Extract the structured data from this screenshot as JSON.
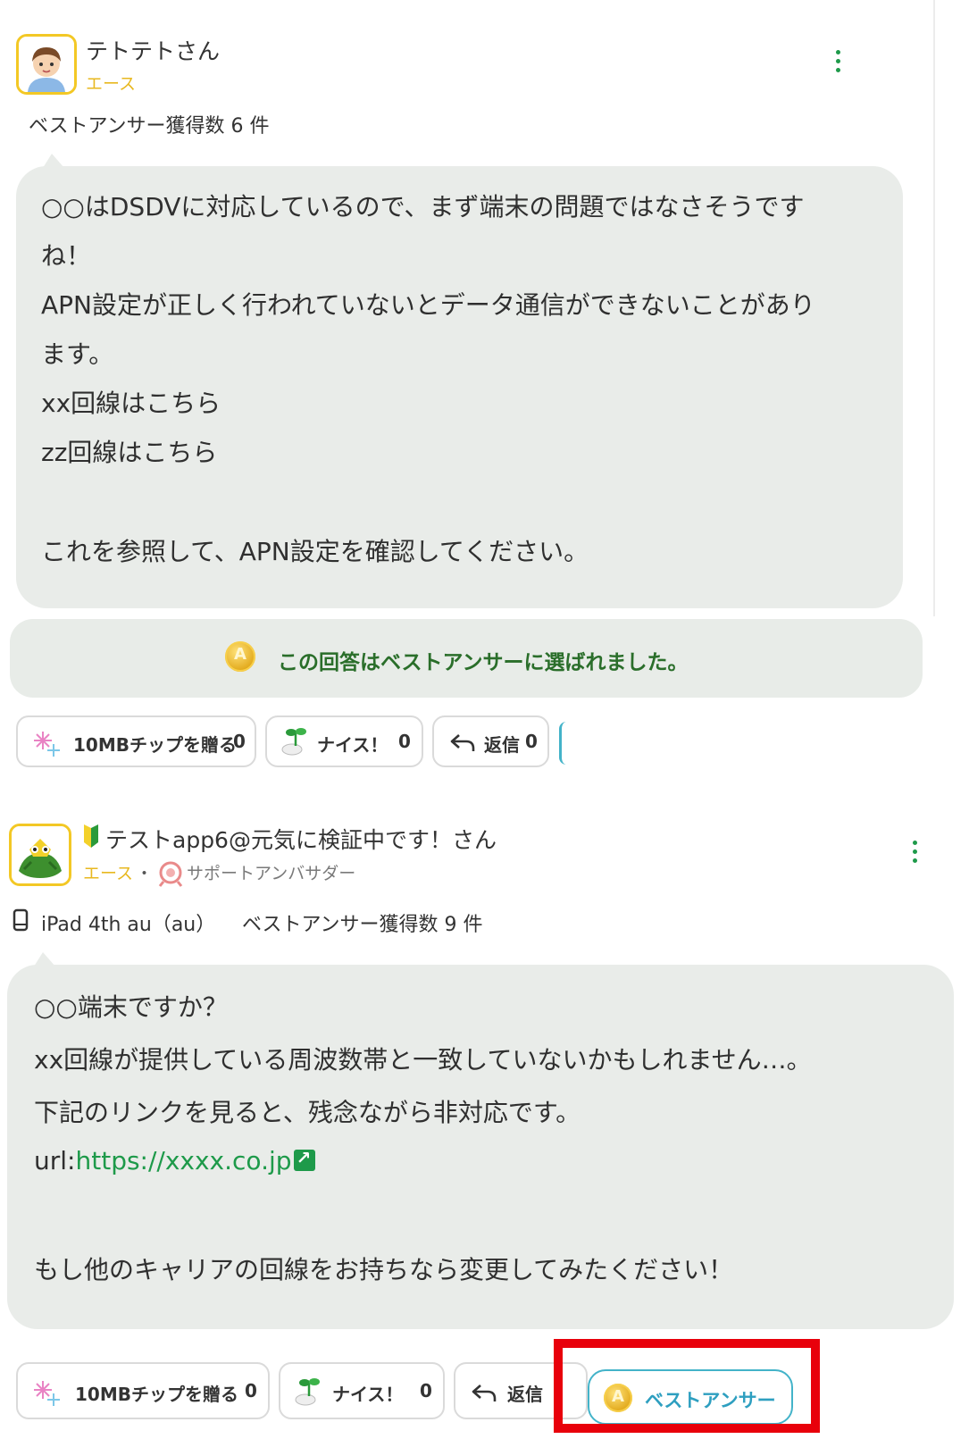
{
  "post1": {
    "username": "テトテトさん",
    "rank": "エース",
    "best_count": "ベストアンサー獲得数 6 件",
    "lines": [
      "○○はDSDVに対応しているので、まず端末の問題ではなさそうです",
      "ね！",
      "APN設定が正しく行われていないとデータ通信ができないことがあり",
      "ます。",
      "xx回線はこちら",
      "zz回線はこちら",
      "これを参照して、APN設定を確認してください。"
    ],
    "best_banner": "この回答はベストアンサーに選ばれました。",
    "actions": {
      "tip_label": "10MBチップを贈る",
      "tip_count": "0",
      "nice_label": "ナイス！",
      "nice_count": "0",
      "reply_label": "返信",
      "reply_count": "0"
    }
  },
  "post2": {
    "username": "テストapp6@元気に検証中です！さん",
    "rank": "エース",
    "separator": "・",
    "ambassador": "サポートアンバサダー",
    "device": "iPad 4th au（au）",
    "best_count": "ベストアンサー獲得数 9 件",
    "lines": [
      "○○端末ですか？",
      "xx回線が提供している周波数帯と一致していないかもしれません…。",
      "下記のリンクを見ると、残念ながら非対応です。",
      "url:",
      "もし他のキャリアの回線をお持ちなら変更してみたください！"
    ],
    "link_text": "https://xxxx.co.jp",
    "actions": {
      "tip_label": "10MBチップを贈る",
      "tip_count": "0",
      "nice_label": "ナイス！",
      "nice_count": "0",
      "reply_label": "返信",
      "best_answer_label": "ベストアンサー"
    }
  },
  "colors": {
    "accent_green": "#1e9a4a",
    "rank_yellow": "#e8b820",
    "bubble_bg": "#e9ece9",
    "best_btn": "#43b3c9",
    "highlight_red": "#e8000b"
  },
  "icons": [
    "avatar-boy",
    "avatar-frog",
    "beginner-mark-icon",
    "ambassador-icon",
    "device-icon",
    "kebab-menu-icon",
    "gold-coin-icon",
    "firework-icon",
    "nice-sprout-icon",
    "reply-icon",
    "external-link-icon"
  ]
}
